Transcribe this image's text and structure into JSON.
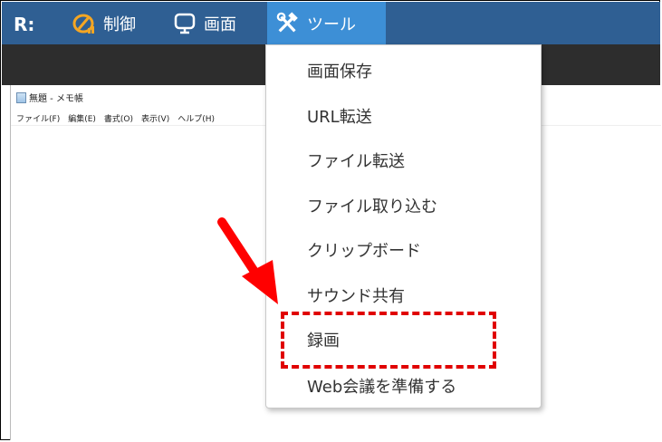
{
  "toolbar": {
    "logo": "R:",
    "items": [
      {
        "label": "制御",
        "icon": "control-icon"
      },
      {
        "label": "画面",
        "icon": "monitor-icon"
      },
      {
        "label": "ツール",
        "icon": "tools-icon",
        "active": true
      }
    ],
    "colors": {
      "bar": "#2f5f93",
      "active": "#3d8fd6",
      "control_icon": "#f5a623"
    }
  },
  "notepad": {
    "title": "無題 - メモ帳",
    "menu": [
      "ファイル(F)",
      "編集(E)",
      "書式(O)",
      "表示(V)",
      "ヘルプ(H)"
    ]
  },
  "dropdown": {
    "items": [
      "画面保存",
      "URL転送",
      "ファイル転送",
      "ファイル取り込む",
      "クリップボード",
      "サウンド共有",
      "録画",
      "Web会議を準備する"
    ]
  },
  "annotation": {
    "highlight_color": "#e00000",
    "highlighted_item": "録画"
  }
}
